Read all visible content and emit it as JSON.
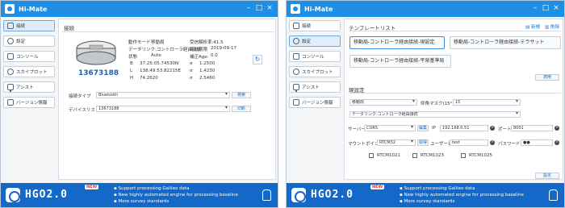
{
  "app": {
    "title": "Hi-Mate"
  },
  "sidebar": {
    "items": [
      {
        "label": "接続"
      },
      {
        "label": "設定"
      },
      {
        "label": "コンソール"
      },
      {
        "label": "スカイプロット"
      },
      {
        "label": "アシスト"
      },
      {
        "label": "バージョン情報"
      }
    ]
  },
  "left": {
    "section_title": "接続",
    "device_serial": "13673188",
    "info": {
      "device_mode_label": "動作モード",
      "device_mode_value": "移動局",
      "receive_rate": "受信解析率:41.5",
      "datalink_label": "データリンク:コントローラ経由接続",
      "expiry_label": "有効期限",
      "expiry_value": "2019-09-17",
      "status_label": "状態",
      "status_value": "Auto",
      "correction_label": "補正Age:",
      "correction_value": "0.0",
      "b_label": "B",
      "b_value": "37:25:05.74530N",
      "sigma1": "σ",
      "b_sigma": "1.2500",
      "l_label": "L",
      "l_value": "138:49:53.82215E",
      "sigma2": "σ",
      "l_sigma": "1.4230",
      "h_label": "H",
      "h_value": "74.2620",
      "sigma3": "σ",
      "h_sigma": "2.5460"
    },
    "conn_type_label": "接続タイプ",
    "conn_type_value": "Bluetooth",
    "search_button": "検索",
    "device_list_label": "デバイスリスト",
    "device_list_value": "13673188",
    "disconnect_button": "切断"
  },
  "right": {
    "template_list_title": "テンプレートリスト",
    "new_label": "新規",
    "delete_label": "削除",
    "templates": [
      "移動局-コントローラ経由接続-現設定",
      "移動局-コントローラ経由接続-テラサット",
      "移動局-コントローラ経由接続-平泉基準局"
    ],
    "apply_button": "適用",
    "current_settings_title": "現設定",
    "mode_value": "移動局",
    "elevation_mask_label": "仰角マスク(15°)",
    "elevation_mask_value": "15",
    "datalink_value": "データリンク:コントローラ経由接続",
    "server_label": "サーバー",
    "server_value": "CORS",
    "server_button": "編集",
    "ip_label": "IP",
    "ip_value": "192.168.0.51",
    "port_label": "ポート",
    "port_value": "8001",
    "mountpoint_label": "マウントポイント",
    "mountpoint_value": "RTCM32",
    "fetch_button": "取得",
    "user_label": "ユーザー名",
    "user_value": "test",
    "password_label": "パスワード",
    "password_value": "●●",
    "checkboxes": [
      "RTCM1021",
      "RTCM1023",
      "RTCM1025"
    ],
    "settings_button": "設定"
  },
  "footer": {
    "brand": "HGO2.0",
    "new_badge": "NEW",
    "features": [
      "Support processing Galileo data",
      "New highly automated engine for processing baseline",
      "More survey standards"
    ]
  },
  "colors": {
    "titlebar": "#1f8fe6",
    "footer": "#1468c8",
    "active_nav": "#dfeefc"
  }
}
